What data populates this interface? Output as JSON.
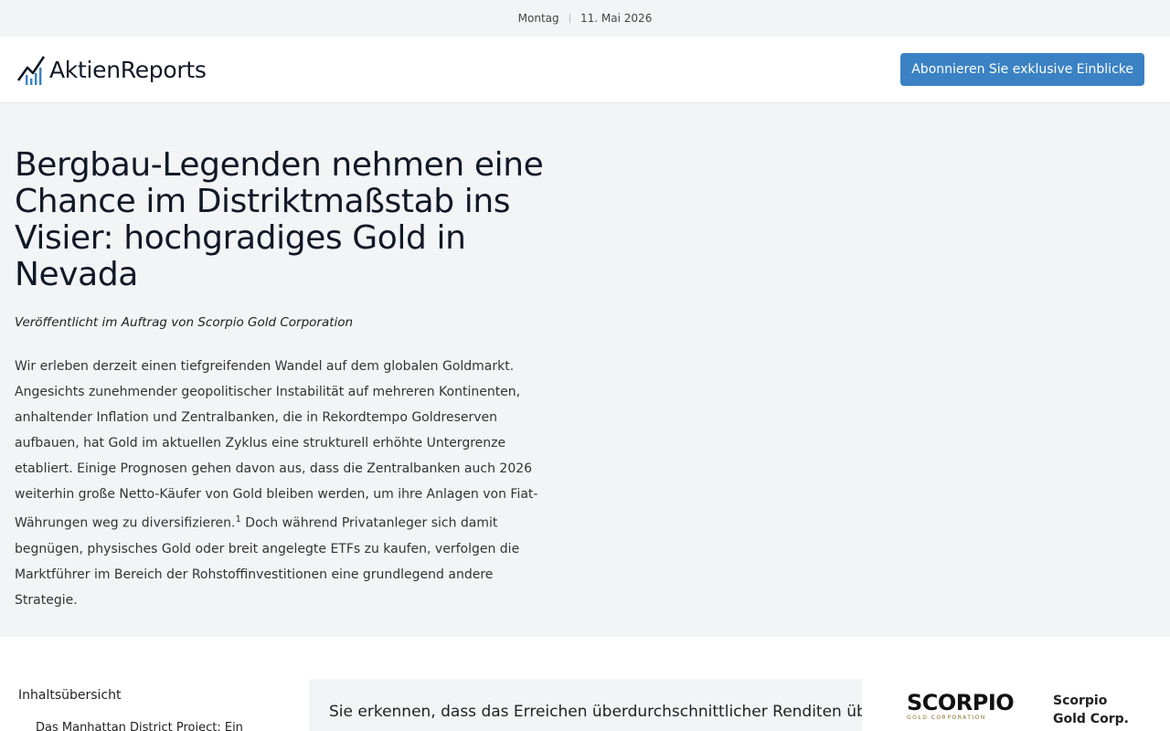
{
  "topbar": {
    "day": "Montag",
    "date": "11. Mai 2026"
  },
  "header": {
    "logo_text": "AktienReports",
    "subscribe_label": "Abonnieren Sie exklusive Einblicke"
  },
  "article": {
    "title": "Bergbau-Legenden nehmen eine Chance im Distriktmaßstab ins Visier: hochgradiges Gold in Nevada",
    "sponsor": "Veröffentlicht im Auftrag von Scorpio Gold Corporation",
    "intro_part1": "Wir erleben derzeit einen tiefgreifenden Wandel auf dem globalen Goldmarkt. Angesichts zunehmender geopolitischer Instabilität auf mehreren Kontinenten, anhaltender Inflation und Zentralbanken, die in Rekordtempo Goldreserven aufbauen, hat Gold im aktuellen Zyklus eine strukturell erhöhte Untergrenze etabliert. Einige Prognosen gehen davon aus, dass die Zentralbanken auch 2026 weiterhin große Netto-Käufer von Gold bleiben werden, um ihre Anlagen von Fiat-Währungen weg zu diversifizieren.",
    "footnote": "1",
    "intro_part2": " Doch während Privatanleger sich damit begnügen, physisches Gold oder breit angelegte ETFs zu kaufen, verfolgen die Marktführer im Bereich der Rohstoffinvestitionen eine grundlegend andere Strategie."
  },
  "toc": {
    "title": "Inhaltsübersicht",
    "first_item": "Das Manhattan District Project: Ein"
  },
  "callout": {
    "text": "Sie erkennen, dass das Erreichen überdurchschnittlicher Renditen über"
  },
  "company": {
    "logo_word": "SCORPIO",
    "logo_sub": "GOLD CORPORATION",
    "name": "Scorpio Gold Corp."
  },
  "colors": {
    "accent": "#3b82c4",
    "hero_bg": "#f3f4f6",
    "gold": "#8b6f2a"
  }
}
